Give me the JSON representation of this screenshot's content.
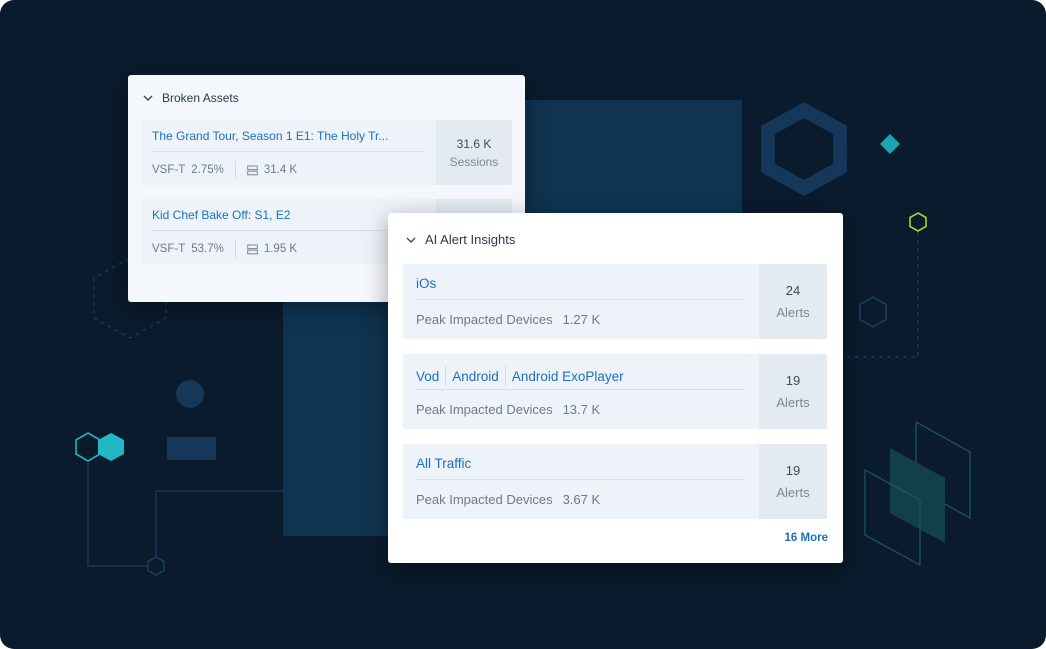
{
  "broken_assets": {
    "title": "Broken Assets",
    "items": [
      {
        "title": "The Grand Tour, Season 1 E1: The Holy Tr...",
        "metric_label": "VSF-T",
        "metric_value": "2.75%",
        "count": "31.4 K",
        "side_value": "31.6 K",
        "side_label": "Sessions"
      },
      {
        "title": "Kid Chef Bake Off: S1, E2",
        "metric_label": "VSF-T",
        "metric_value": "53.7%",
        "count": "1.95 K",
        "side_value": "",
        "side_label": ""
      }
    ]
  },
  "ai_alerts": {
    "title": "AI Alert Insights",
    "items": [
      {
        "tags": [
          "iOs"
        ],
        "metric_label": "Peak Impacted Devices",
        "metric_value": "1.27 K",
        "count": "24",
        "count_label": "Alerts"
      },
      {
        "tags": [
          "Vod",
          "Android",
          "Android ExoPlayer"
        ],
        "metric_label": "Peak Impacted Devices",
        "metric_value": "13.7 K",
        "count": "19",
        "count_label": "Alerts"
      },
      {
        "tags": [
          "All Traffic"
        ],
        "metric_label": "Peak Impacted Devices",
        "metric_value": "3.67 K",
        "count": "19",
        "count_label": "Alerts"
      }
    ],
    "more_label": "16 More"
  },
  "colors": {
    "background": "#0a1b2d",
    "panel": "#0f3350",
    "accent_teal": "#1fa3b0",
    "accent_lime": "#a6d92b",
    "link_blue": "#1b6fc2"
  }
}
